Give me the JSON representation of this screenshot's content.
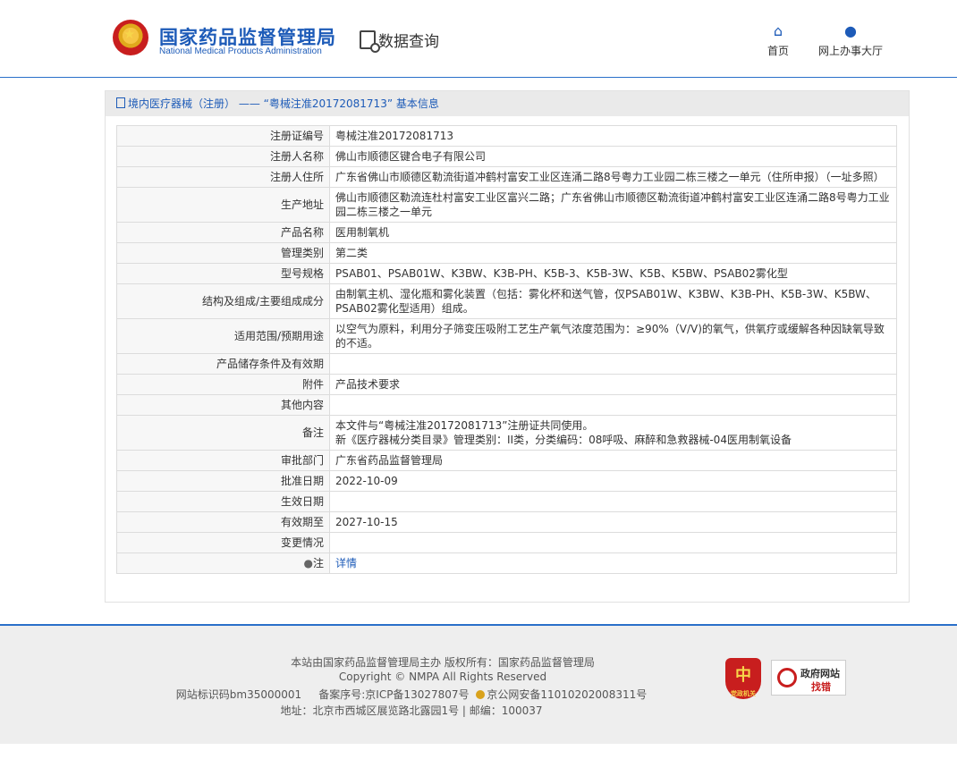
{
  "header": {
    "logo_cn": "国家药品监督管理局",
    "logo_en": "National Medical Products Administration",
    "data_query": "数据查询",
    "nav": [
      {
        "label": "首页",
        "icon": "home-icon"
      },
      {
        "label": "网上办事大厅",
        "icon": "user-icon"
      }
    ]
  },
  "panel": {
    "title": "境内医疗器械（注册） —— “粤械注准20172081713” 基本信息"
  },
  "rows": [
    {
      "label": "注册证编号",
      "value": "粤械注准20172081713"
    },
    {
      "label": "注册人名称",
      "value": "佛山市顺德区键合电子有限公司"
    },
    {
      "label": "注册人住所",
      "value": "广东省佛山市顺德区勒流街道冲鹤村富安工业区连涌二路8号粤力工业园二栋三楼之一单元（住所申报）（一址多照）"
    },
    {
      "label": "生产地址",
      "value": "佛山市顺德区勒流连杜村富安工业区富兴二路；广东省佛山市顺德区勒流街道冲鹤村富安工业区连涌二路8号粤力工业园二栋三楼之一单元"
    },
    {
      "label": "产品名称",
      "value": "医用制氧机"
    },
    {
      "label": "管理类别",
      "value": "第二类"
    },
    {
      "label": "型号规格",
      "value": "PSAB01、PSAB01W、K3BW、K3B-PH、K5B-3、K5B-3W、K5B、K5BW、PSAB02雾化型"
    },
    {
      "label": "结构及组成/主要组成成分",
      "value": "由制氧主机、湿化瓶和雾化装置（包括：雾化杯和送气管，仅PSAB01W、K3BW、K3B-PH、K5B-3W、K5BW、PSAB02雾化型适用）组成。"
    },
    {
      "label": "适用范围/预期用途",
      "value": "以空气为原料，利用分子筛变压吸附工艺生产氧气浓度范围为：≥90%（V/V)的氧气，供氧疗或缓解各种因缺氧导致的不适。"
    },
    {
      "label": "产品储存条件及有效期",
      "value": ""
    },
    {
      "label": "附件",
      "value": "产品技术要求"
    },
    {
      "label": "其他内容",
      "value": ""
    },
    {
      "label": "备注",
      "value": "本文件与“粤械注准20172081713”注册证共同使用。",
      "value2": "新《医疗器械分类目录》管理类别：II类，分类编码：08呼吸、麻醉和急救器械-04医用制氧设备"
    },
    {
      "label": "审批部门",
      "value": "广东省药品监督管理局"
    },
    {
      "label": "批准日期",
      "value": "2022-10-09"
    },
    {
      "label": "生效日期",
      "value": ""
    },
    {
      "label": "有效期至",
      "value": "2027-10-15"
    },
    {
      "label": "变更情况",
      "value": ""
    },
    {
      "label": "注",
      "value": "详情"
    }
  ],
  "footer": {
    "line1": "本站由国家药品监督管理局主办 版权所有：国家药品监督管理局",
    "line2": "Copyright © NMPA All Rights Reserved",
    "icp_site": "网站标识码bm35000001",
    "icp_record": "备案序号:京ICP备13027807号",
    "police_record": "京公网安备11010202008311号",
    "address": "地址：北京市西城区展览路北露园1号 | 邮编：100037",
    "badge_gov": "党政机关",
    "badge_find_error_1": "政府网站",
    "badge_find_error_2": "找错"
  }
}
